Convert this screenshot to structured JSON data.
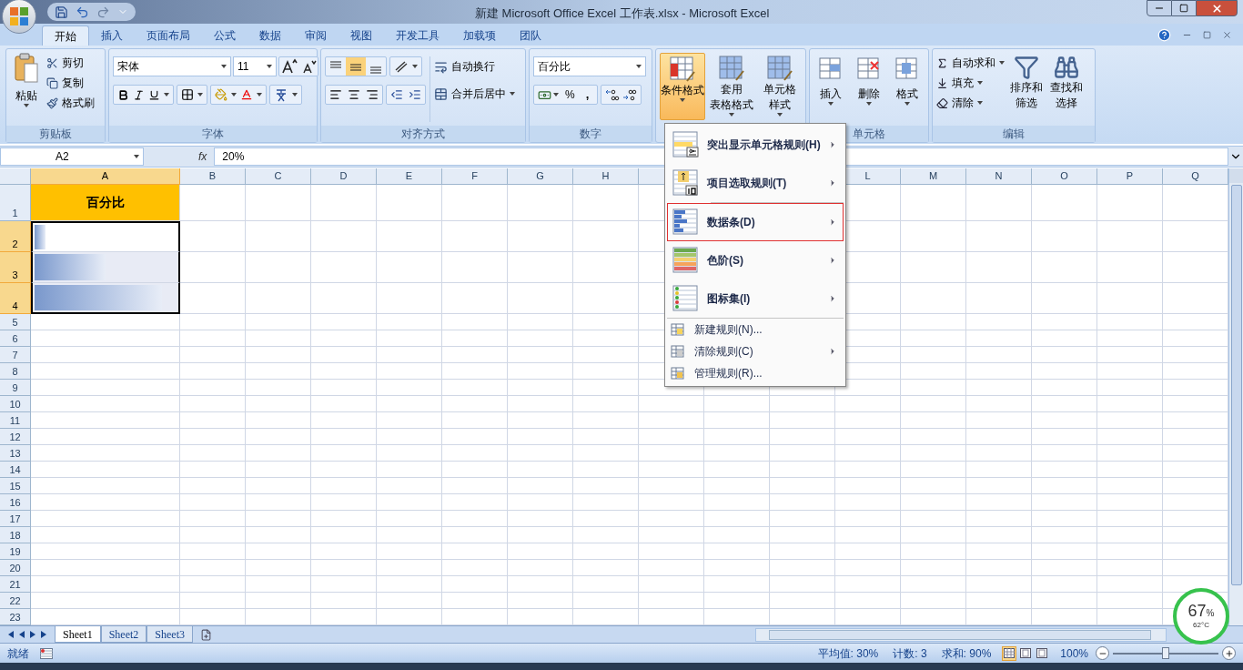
{
  "title": "新建 Microsoft Office Excel 工作表.xlsx - Microsoft Excel",
  "tabs": [
    {
      "label": "开始",
      "selected": true
    },
    {
      "label": "插入",
      "selected": false
    },
    {
      "label": "页面布局",
      "selected": false
    },
    {
      "label": "公式",
      "selected": false
    },
    {
      "label": "数据",
      "selected": false
    },
    {
      "label": "审阅",
      "selected": false
    },
    {
      "label": "视图",
      "selected": false
    },
    {
      "label": "开发工具",
      "selected": false
    },
    {
      "label": "加载项",
      "selected": false
    },
    {
      "label": "团队",
      "selected": false
    }
  ],
  "ribbon": {
    "clipboard": {
      "label": "剪贴板",
      "paste": "粘贴",
      "items": [
        "剪切",
        "复制",
        "格式刷"
      ]
    },
    "font": {
      "label": "字体",
      "font_name": "宋体",
      "font_size": "11"
    },
    "alignment": {
      "label": "对齐方式",
      "wrap": "自动换行",
      "merge": "合并后居中"
    },
    "number": {
      "label": "数字",
      "format": "百分比",
      "percent": "%",
      "comma": ","
    },
    "styles": {
      "buttons": [
        {
          "lines": [
            "条件格式"
          ],
          "selected": true
        },
        {
          "lines": [
            "套用",
            "表格格式"
          ],
          "selected": false
        },
        {
          "lines": [
            "单元格",
            "样式"
          ],
          "selected": false
        }
      ]
    },
    "cells": {
      "label": "单元格",
      "buttons": [
        "插入",
        "删除",
        "格式"
      ]
    },
    "editing": {
      "label": "编辑",
      "items": [
        "自动求和",
        "填充",
        "清除"
      ],
      "buttons": [
        [
          "排序和",
          "筛选"
        ],
        [
          "查找和",
          "选择"
        ]
      ]
    }
  },
  "formula_bar": {
    "name_box": "A2",
    "fx": "fx",
    "value": "20%"
  },
  "columns": [
    {
      "label": "A",
      "selected": true
    },
    {
      "label": "B",
      "selected": false
    },
    {
      "label": "C",
      "selected": false
    },
    {
      "label": "D",
      "selected": false
    },
    {
      "label": "E",
      "selected": false
    },
    {
      "label": "F",
      "selected": false
    },
    {
      "label": "G",
      "selected": false
    },
    {
      "label": "H",
      "selected": false
    },
    {
      "label": "L",
      "selected": false
    },
    {
      "label": "M",
      "selected": false
    },
    {
      "label": "N",
      "selected": false
    },
    {
      "label": "O",
      "selected": false
    },
    {
      "label": "P",
      "selected": false
    },
    {
      "label": "Q",
      "selected": false
    }
  ],
  "rows": [
    {
      "label": "1",
      "selected": false,
      "cell": {
        "kind": "header",
        "text": "百分比"
      }
    },
    {
      "label": "2",
      "selected": true,
      "cell": {
        "kind": "databar",
        "level": 0.08,
        "active": true
      }
    },
    {
      "label": "3",
      "selected": true,
      "cell": {
        "kind": "databar",
        "level": 0.5,
        "active": false
      }
    },
    {
      "label": "4",
      "selected": true,
      "cell": {
        "kind": "databar",
        "level": 0.9,
        "active": false
      }
    },
    {
      "label": "5",
      "selected": false
    },
    {
      "label": "6",
      "selected": false
    },
    {
      "label": "7",
      "selected": false
    },
    {
      "label": "8",
      "selected": false
    },
    {
      "label": "9",
      "selected": false
    },
    {
      "label": "10",
      "selected": false
    },
    {
      "label": "11",
      "selected": false
    },
    {
      "label": "12",
      "selected": false
    },
    {
      "label": "13",
      "selected": false
    },
    {
      "label": "14",
      "selected": false
    },
    {
      "label": "15",
      "selected": false
    },
    {
      "label": "16",
      "selected": false
    },
    {
      "label": "17",
      "selected": false
    },
    {
      "label": "18",
      "selected": false
    },
    {
      "label": "19",
      "selected": false
    },
    {
      "label": "20",
      "selected": false
    },
    {
      "label": "21",
      "selected": false
    },
    {
      "label": "22",
      "selected": false
    },
    {
      "label": "23",
      "selected": false
    }
  ],
  "menu": {
    "items": [
      {
        "kind": "large",
        "label": "突出显示单元格规则(H)",
        "submenu": true,
        "highlighted": false
      },
      {
        "kind": "large",
        "label": "项目选取规则(T)",
        "submenu": true,
        "highlighted": false
      },
      {
        "kind": "large",
        "label": "数据条(D)",
        "submenu": true,
        "highlighted": true
      },
      {
        "kind": "large",
        "label": "色阶(S)",
        "submenu": true,
        "highlighted": false
      },
      {
        "kind": "large",
        "label": "图标集(I)",
        "submenu": true,
        "highlighted": false
      },
      {
        "kind": "small",
        "label": "新建规则(N)...",
        "submenu": false,
        "highlighted": false
      },
      {
        "kind": "small",
        "label": "清除规则(C)",
        "submenu": true,
        "highlighted": false
      },
      {
        "kind": "small",
        "label": "管理规则(R)...",
        "submenu": false,
        "highlighted": false
      }
    ]
  },
  "sheet_tabs": [
    {
      "label": "Sheet1",
      "selected": true
    },
    {
      "label": "Sheet2",
      "selected": false
    },
    {
      "label": "Sheet3",
      "selected": false
    }
  ],
  "status_bar": {
    "mode": "就绪",
    "stats": [
      "平均值: 30%",
      "计数: 3",
      "求和: 90%"
    ],
    "views": [
      {
        "selected": true
      },
      {
        "selected": false
      },
      {
        "selected": false
      }
    ],
    "zoom": "100%",
    "zoom_slider": {
      "level": 0.5
    }
  },
  "widget": {
    "usage": "67",
    "unit": "%",
    "temp": "62°C"
  }
}
